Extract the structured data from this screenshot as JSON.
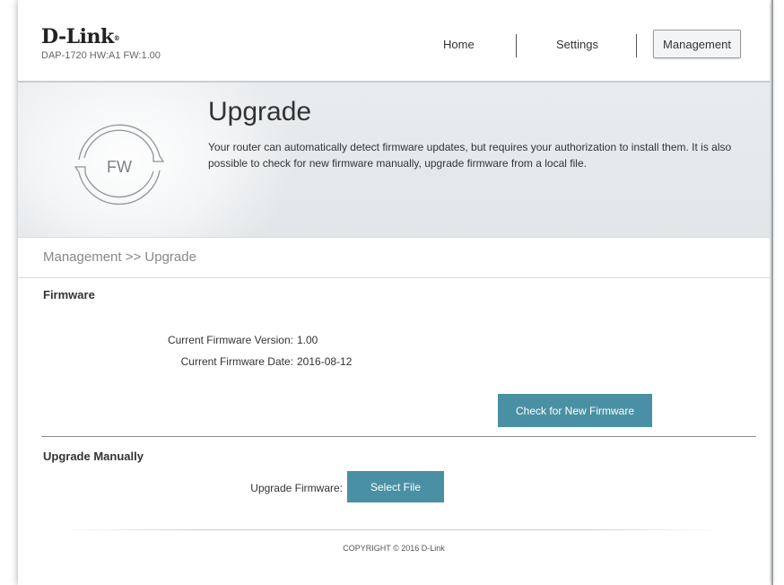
{
  "header": {
    "logo": "D-Link",
    "logo_mark": "®",
    "hw_info": "DAP-1720 HW:A1 FW:1.00",
    "nav": {
      "home": "Home",
      "settings": "Settings",
      "management": "Management"
    },
    "active_nav": "Management"
  },
  "banner": {
    "icon_text": "FW",
    "title": "Upgrade",
    "description": "Your router can automatically detect firmware updates, but requires your authorization to install them. It is also possible to check for new firmware manually, upgrade firmware from a local file."
  },
  "breadcrumb": "Management >> Upgrade",
  "firmware": {
    "section_title": "Firmware",
    "version_label": "Current Firmware Version:",
    "version_value": "1.00",
    "date_label": "Current Firmware Date:",
    "date_value": "2016-08-12",
    "check_button": "Check for New Firmware"
  },
  "manual": {
    "section_title": "Upgrade Manually",
    "upgrade_label": "Upgrade Firmware:",
    "select_button": "Select File"
  },
  "footer": {
    "copyright": "COPYRIGHT © 2016 D-Link"
  },
  "colors": {
    "accent": "#4a90a4",
    "banner_bg": "#e5e8eb",
    "text": "#333333"
  }
}
